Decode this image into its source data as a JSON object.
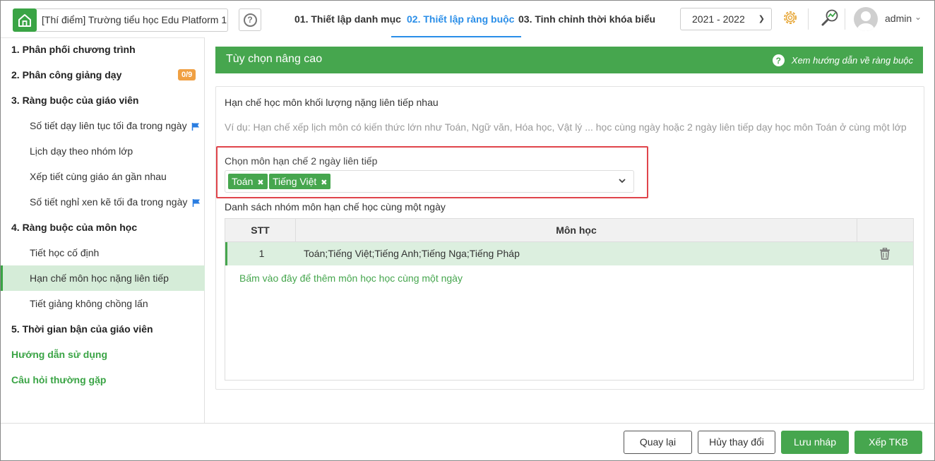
{
  "header": {
    "school_name": "[Thí điểm] Trường tiểu học Edu Platform 1",
    "tabs": [
      {
        "label": "01. Thiết lập danh mục"
      },
      {
        "label": "02. Thiết lập ràng buộc"
      },
      {
        "label": "03. Tinh chỉnh thời khóa biểu"
      }
    ],
    "school_year": "2021 - 2022",
    "user_name": "admin",
    "accent_color": "#2a8ee8"
  },
  "sidebar": {
    "items": [
      {
        "label": "1. Phân phối chương trình",
        "type": "section"
      },
      {
        "label": "2. Phân công giảng dạy",
        "type": "section",
        "badge": "0/9"
      },
      {
        "label": "3. Ràng buộc của giáo viên",
        "type": "section"
      },
      {
        "label": "Số tiết dạy liên tục tối đa trong ngày",
        "type": "sub",
        "flag": true
      },
      {
        "label": "Lịch dạy theo nhóm lớp",
        "type": "sub"
      },
      {
        "label": "Xếp tiết cùng giáo án gần nhau",
        "type": "sub"
      },
      {
        "label": "Số tiết nghỉ xen kẽ tối đa trong ngày",
        "type": "sub",
        "flag": true
      },
      {
        "label": "4. Ràng buộc của môn học",
        "type": "section"
      },
      {
        "label": "Tiết học cố định",
        "type": "sub"
      },
      {
        "label": "Hạn chế môn học nặng liên tiếp",
        "type": "sub",
        "active": true
      },
      {
        "label": "Tiết giảng không chồng lấn",
        "type": "sub"
      },
      {
        "label": "5. Thời gian bận của giáo viên",
        "type": "section"
      },
      {
        "label": "Hướng dẫn sử dụng",
        "type": "link"
      },
      {
        "label": "Câu hỏi thường gặp",
        "type": "link"
      }
    ]
  },
  "panel": {
    "title": "Tùy chọn nâng cao",
    "guide_link": "Xem hướng dẫn về ràng buộc",
    "brand_color": "#46a64e"
  },
  "card": {
    "title": "Hạn chế học môn khối lượng nặng liên tiếp nhau",
    "example": "Ví dụ: Hạn chế xếp lịch môn có kiến thức lớn như Toán, Ngữ văn, Hóa học, Vật lý ... học cùng ngày hoặc 2 ngày liên tiếp dạy học môn Toán ở cùng một lớp",
    "select_label": "Chọn môn hạn chế 2 ngày liên tiếp",
    "selected_subjects": [
      "Toán",
      "Tiếng Việt"
    ],
    "list_label": "Danh sách nhóm môn hạn chế học cùng một ngày",
    "table": {
      "columns": [
        "STT",
        "Môn học"
      ],
      "rows": [
        {
          "stt": "1",
          "subjects": "Toán;Tiếng Việt;Tiếng Anh;Tiếng Nga;Tiếng Pháp"
        }
      ],
      "add_link": "Bấm vào đây để thêm môn học học cùng một ngày"
    }
  },
  "footer": {
    "back": "Quay lại",
    "cancel": "Hủy thay đổi",
    "save_draft": "Lưu nháp",
    "schedule": "Xếp TKB"
  }
}
